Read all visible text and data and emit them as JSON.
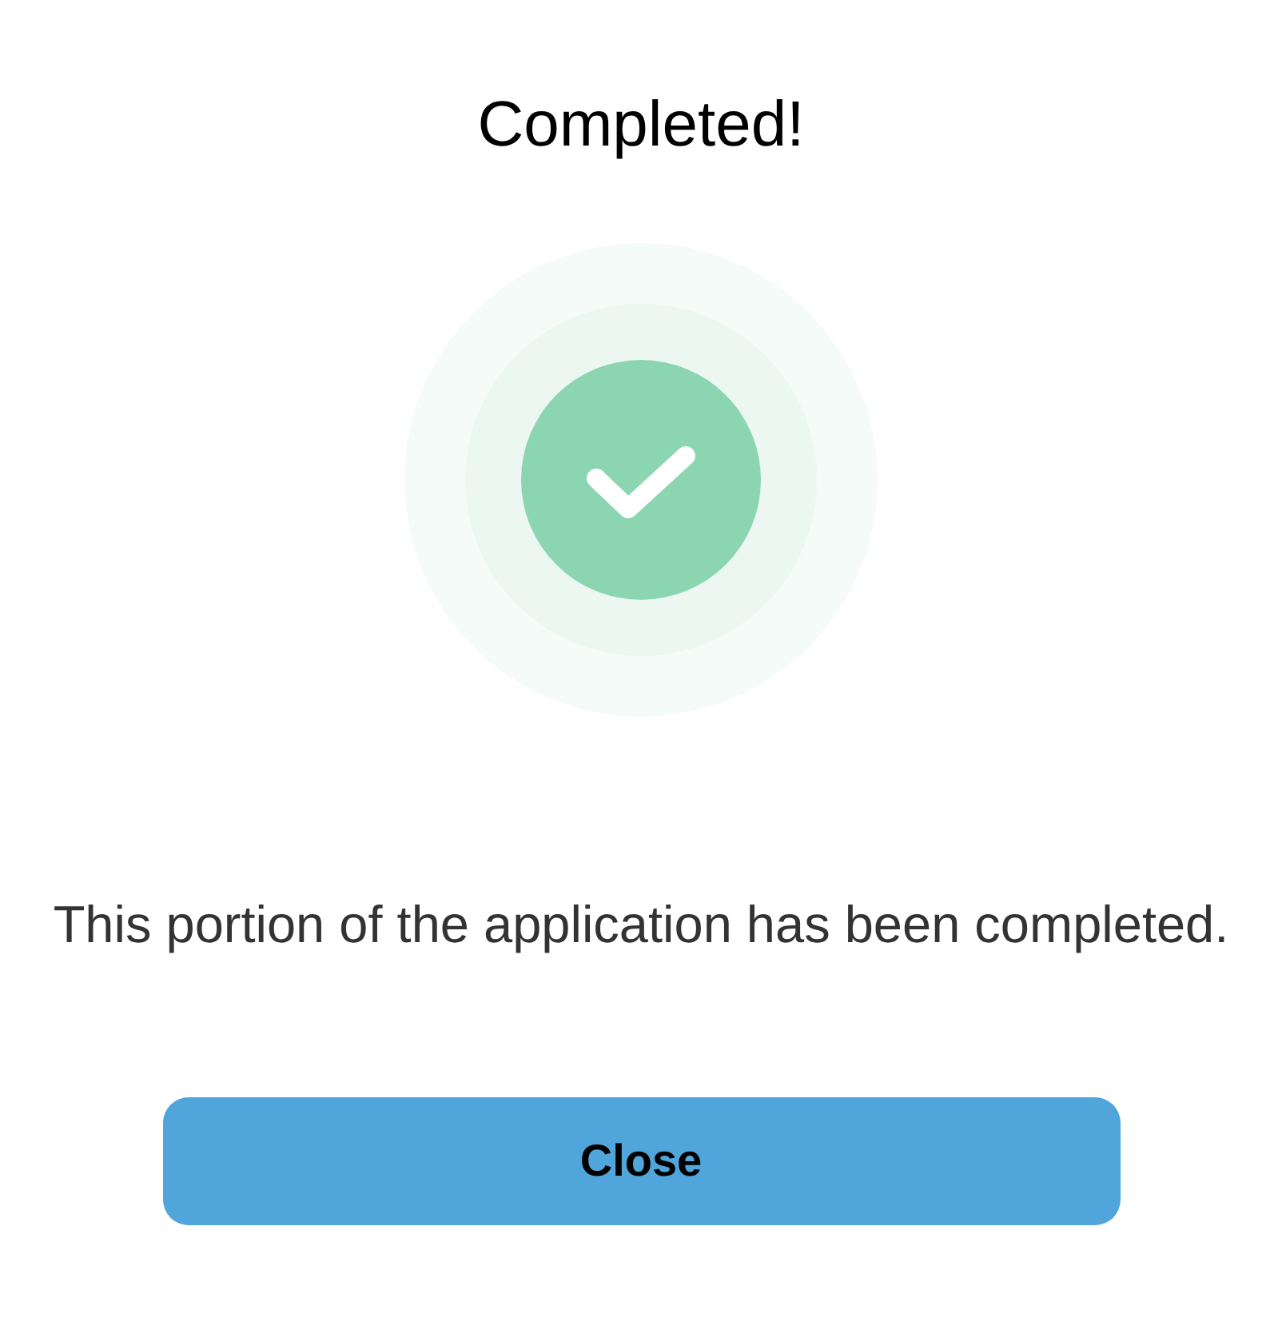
{
  "dialog": {
    "title": "Completed!",
    "message": "This portion of the application has been completed.",
    "buttons": [
      {
        "label": "Close"
      }
    ]
  }
}
